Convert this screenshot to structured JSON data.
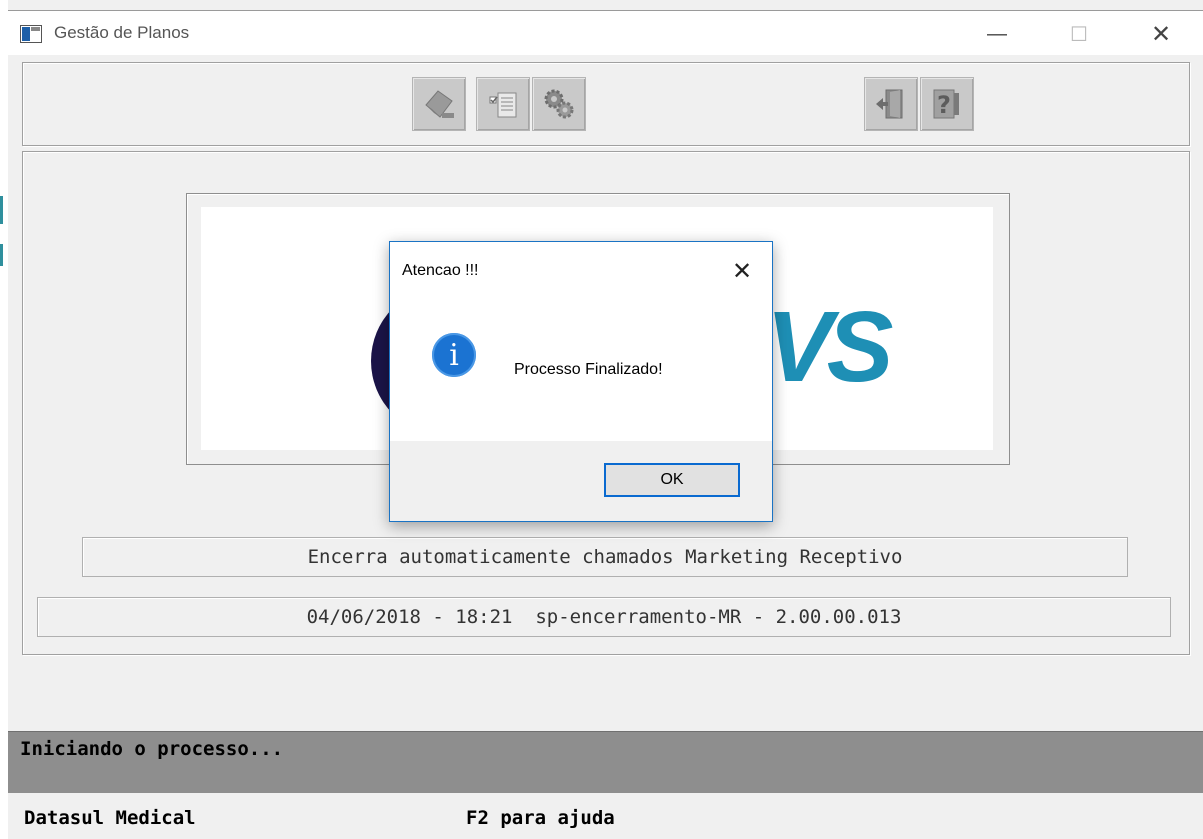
{
  "window": {
    "title": "Gestão de Planos",
    "minimize_glyph": "—",
    "maximize_glyph": "☐",
    "close_glyph": "✕"
  },
  "toolbar": {
    "buttons": [
      {
        "icon": "eraser-icon"
      },
      {
        "icon": "checklist-icon"
      },
      {
        "icon": "gears-icon"
      },
      {
        "icon": "exit-door-icon"
      },
      {
        "icon": "help-icon"
      }
    ]
  },
  "logo": {
    "visible_text": "VS",
    "circle_color": "#1b1448",
    "text_color": "#1e8fb5"
  },
  "program": {
    "description": "Encerra automaticamente chamados Marketing Receptivo",
    "version_line": "04/06/2018 - 18:21  sp-encerramento-MR - 2.00.00.013"
  },
  "status": {
    "message": "Iniciando o processo...",
    "app_name": "Datasul Medical",
    "help_hint": "F2 para ajuda"
  },
  "dialog": {
    "title": "Atencao !!!",
    "close_glyph": "✕",
    "icon": "info-icon",
    "icon_glyph": "i",
    "message": "Processo Finalizado!",
    "ok_label": "OK"
  },
  "colors": {
    "accent": "#1a73c4",
    "status_bar": "#8e8e8e"
  }
}
